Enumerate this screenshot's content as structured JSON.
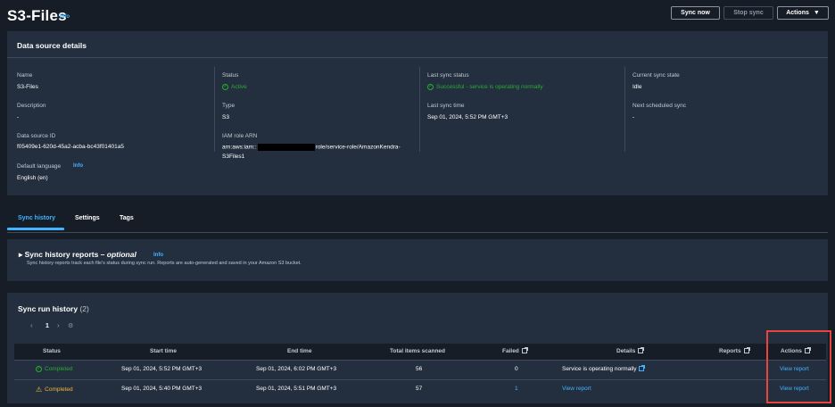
{
  "header": {
    "title": "S3-Files",
    "info": "Info",
    "sync_now": "Sync now",
    "stop_sync": "Stop sync",
    "actions": "Actions"
  },
  "details": {
    "title": "Data source details",
    "name_label": "Name",
    "name_value": "S3-Files",
    "description_label": "Description",
    "description_value": "-",
    "id_label": "Data source ID",
    "id_value": "f05409e1-620d-45a2-acba-bc43f01401a5",
    "language_label": "Default language",
    "language_info": "Info",
    "language_value": "English (en)",
    "status_label": "Status",
    "status_value": "Active",
    "type_label": "Type",
    "type_value": "S3",
    "iam_label": "IAM role ARN",
    "iam_prefix": "arn:aws:iam::",
    "iam_suffix": "role/service-role/AmazonKendra-",
    "iam_suffix2": "S3Files1",
    "last_status_label": "Last sync status",
    "last_status_value": "Successful - service is operating normally",
    "last_time_label": "Last sync time",
    "last_time_value": "Sep 01, 2024, 5:52 PM GMT+3",
    "current_state_label": "Current sync state",
    "current_state_value": "Idle",
    "next_label": "Next scheduled sync",
    "next_value": "-"
  },
  "tabs": [
    "Sync history",
    "Settings",
    "Tags"
  ],
  "reports": {
    "title_main": "Sync history reports – ",
    "title_opt": "optional",
    "info": "Info",
    "desc": "Sync history reports track each file's status during sync run. Reports are auto-generated and saved in your Amazon S3 bucket."
  },
  "history": {
    "title": "Sync run history",
    "count": "(2)",
    "page": "1",
    "columns": [
      "Status",
      "Start time",
      "End time",
      "Total items scanned",
      "Failed",
      "Details",
      "Reports",
      "Actions"
    ],
    "rows": [
      {
        "status": "Completed",
        "start": "Sep 01, 2024, 5:52 PM GMT+3",
        "end": "Sep 01, 2024, 6:02 PM GMT+3",
        "total": "56",
        "failed": "0",
        "details": "Service is operating normally",
        "action": "View report"
      },
      {
        "status": "Completed",
        "start": "Sep 01, 2024, 5:40 PM GMT+3",
        "end": "Sep 01, 2024, 5:51 PM GMT+3",
        "total": "57",
        "failed": "1",
        "details": "View report",
        "action": "View report"
      }
    ]
  },
  "colors": {
    "background": "#161d26",
    "panel": "#232f3e",
    "link": "#42b4ff",
    "success": "#29ad32",
    "warning": "#f2b63c",
    "highlight": "#e8453c"
  }
}
